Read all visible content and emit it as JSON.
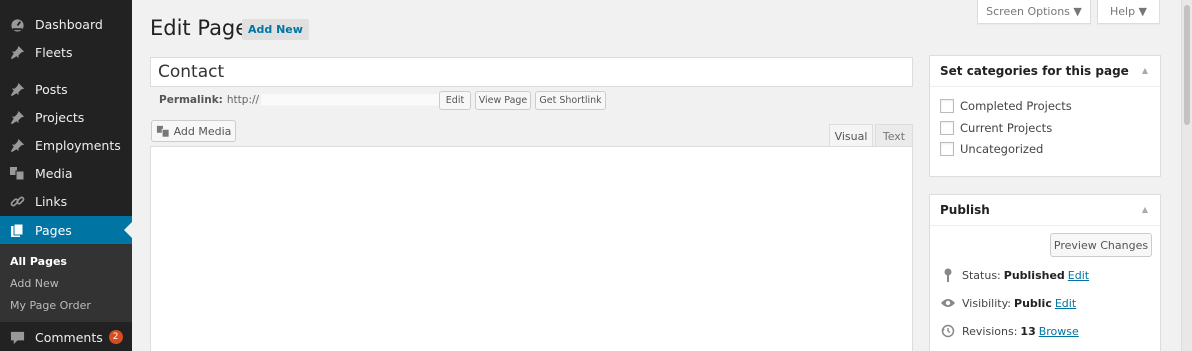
{
  "sidebar": {
    "items": [
      {
        "label": "Dashboard",
        "icon": "dashboard-icon"
      },
      {
        "label": "Fleets",
        "icon": "pin-icon"
      },
      {
        "label": "Posts",
        "icon": "pin-icon"
      },
      {
        "label": "Projects",
        "icon": "pin-icon"
      },
      {
        "label": "Employments",
        "icon": "pin-icon"
      },
      {
        "label": "Media",
        "icon": "media-icon"
      },
      {
        "label": "Links",
        "icon": "link-icon"
      },
      {
        "label": "Pages",
        "icon": "pages-icon"
      },
      {
        "label": "Comments",
        "icon": "comments-icon",
        "badge": "2"
      }
    ],
    "submenu": [
      "All Pages",
      "Add New",
      "My Page Order"
    ]
  },
  "header": {
    "title": "Edit Page",
    "add_new": "Add New",
    "screen_options": "Screen Options ▼",
    "help": "Help ▼"
  },
  "editor": {
    "title_value": "Contact",
    "permalink_label": "Permalink:",
    "permalink_prefix": "http://",
    "edit_btn": "Edit",
    "view_btn": "View Page",
    "shortlink_btn": "Get Shortlink",
    "add_media": "Add Media",
    "tab_visual": "Visual",
    "tab_text": "Text"
  },
  "categories_box": {
    "title": "Set categories for this page",
    "items": [
      "Completed Projects",
      "Current Projects",
      "Uncategorized"
    ]
  },
  "publish_box": {
    "title": "Publish",
    "preview_btn": "Preview Changes",
    "status_label": "Status:",
    "status_value": "Published",
    "visibility_label": "Visibility:",
    "visibility_value": "Public",
    "revisions_label": "Revisions:",
    "revisions_value": "13",
    "edit_link": "Edit",
    "browse_link": "Browse"
  },
  "colors": {
    "accent": "#0074a2",
    "sidebar_bg": "#222222",
    "badge": "#d54e21"
  }
}
